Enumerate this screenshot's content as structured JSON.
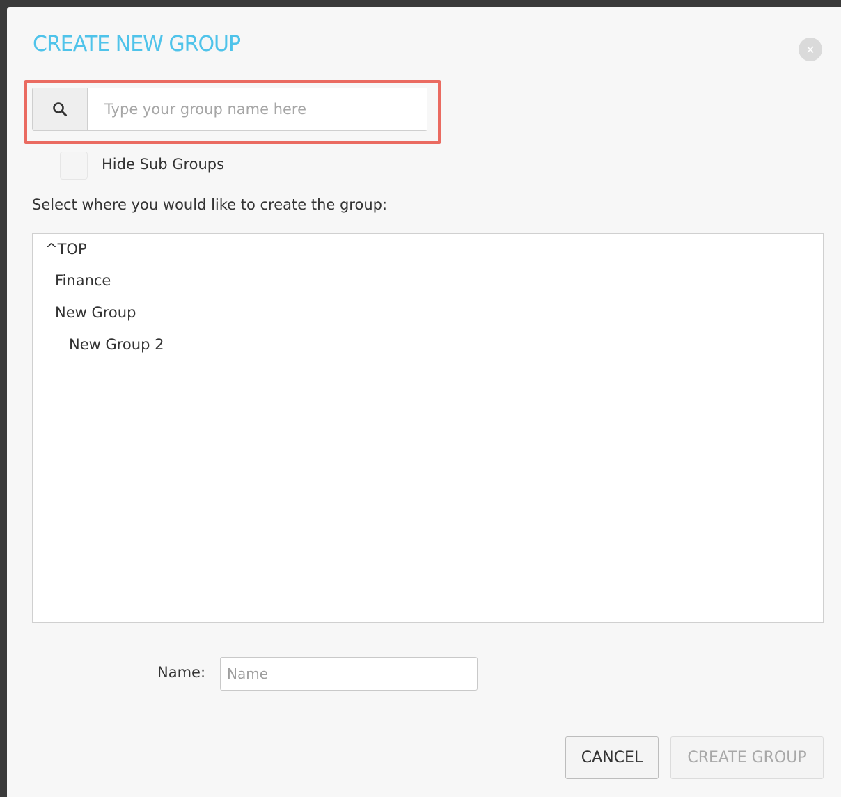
{
  "dialog": {
    "title": "CREATE NEW GROUP",
    "close_icon": "close-icon"
  },
  "search": {
    "icon": "search-icon",
    "placeholder": "Type your group name here",
    "value": ""
  },
  "hide_sub_groups": {
    "label": "Hide Sub Groups",
    "checked": false
  },
  "instruction": "Select where you would like to create the group:",
  "tree": {
    "items": [
      {
        "label": "^TOP",
        "level": 0
      },
      {
        "label": "Finance",
        "level": 1
      },
      {
        "label": "New Group",
        "level": 1
      },
      {
        "label": "New Group 2",
        "level": 2
      }
    ]
  },
  "name_field": {
    "label": "Name:",
    "placeholder": "Name",
    "value": ""
  },
  "buttons": {
    "cancel": "CANCEL",
    "create": "CREATE GROUP"
  },
  "colors": {
    "title": "#4fc3ea",
    "highlight": "#ea6b61"
  }
}
